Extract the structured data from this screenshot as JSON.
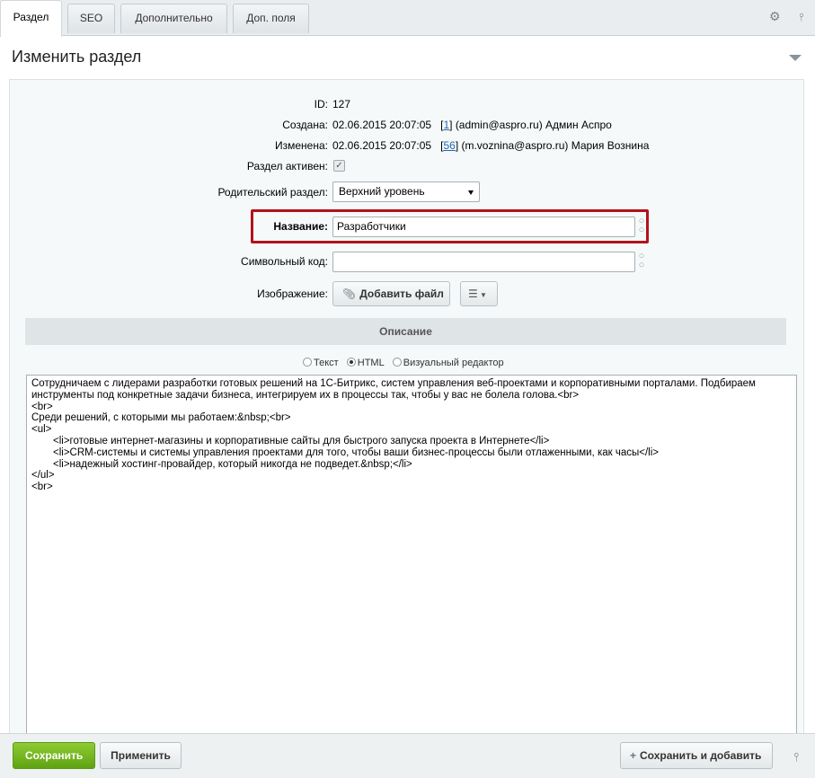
{
  "tabs": [
    {
      "label": "Раздел",
      "active": true
    },
    {
      "label": "SEO",
      "active": false
    },
    {
      "label": "Дополнительно",
      "active": false
    },
    {
      "label": "Доп. поля",
      "active": false
    }
  ],
  "tab_tools": {
    "settings_icon": "⚙",
    "pin_icon": "📌"
  },
  "card": {
    "title": "Изменить раздел"
  },
  "form": {
    "id_label": "ID:",
    "id_value": "127",
    "created_label": "Создана:",
    "created_date": "02.06.2015 20:07:05",
    "created_user_id": "1",
    "created_user": "(admin@aspro.ru) Админ Аспро",
    "modified_label": "Изменена:",
    "modified_date": "02.06.2015 20:07:05",
    "modified_user_id": "56",
    "modified_user": "(m.voznina@aspro.ru) Мария Вознина",
    "active_label": "Раздел активен:",
    "active_checked": true,
    "parent_label": "Родительский раздел:",
    "parent_value": "Верхний уровень",
    "name_label": "Название:",
    "name_value": "Разработчики",
    "code_label": "Символьный код:",
    "code_value": "",
    "image_label": "Изображение:",
    "add_file_label": "Добавить файл"
  },
  "description": {
    "header": "Описание",
    "modes": [
      {
        "label": "Текст",
        "selected": false
      },
      {
        "label": "HTML",
        "selected": true
      },
      {
        "label": "Визуальный редактор",
        "selected": false
      }
    ],
    "lines": [
      {
        "text": "Сотрудничаем с лидерами разработки готовых решений на 1С-Битрикс, систем управления веб-проектами и корпоративными порталами. Подбираем",
        "indent": false
      },
      {
        "text": "инструменты под конкретные задачи бизнеса, интегрируем их в процессы так, чтобы у вас не болела голова.<br>",
        "indent": false
      },
      {
        "text": "<br>",
        "indent": false
      },
      {
        "text": "Среди решений, с которыми мы работаем:&nbsp;<br>",
        "indent": false
      },
      {
        "text": "<ul>",
        "indent": false
      },
      {
        "text": "<li>готовые интернет-магазины и корпоративные сайты для быстрого запуска проекта в Интернете</li>",
        "indent": true
      },
      {
        "text": "<li>CRM-системы и системы управления проектами для того, чтобы ваши бизнес-процессы были отлаженными, как часы</li>",
        "indent": true
      },
      {
        "text": "<li>надежный хостинг-провайдер, который никогда не подведет.&nbsp;</li>",
        "indent": true
      },
      {
        "text": "</ul>",
        "indent": false
      },
      {
        "text": "<br>",
        "indent": false
      }
    ]
  },
  "footer": {
    "save_label": "Сохранить",
    "apply_label": "Применить",
    "save_add_label": "Сохранить и добавить"
  }
}
